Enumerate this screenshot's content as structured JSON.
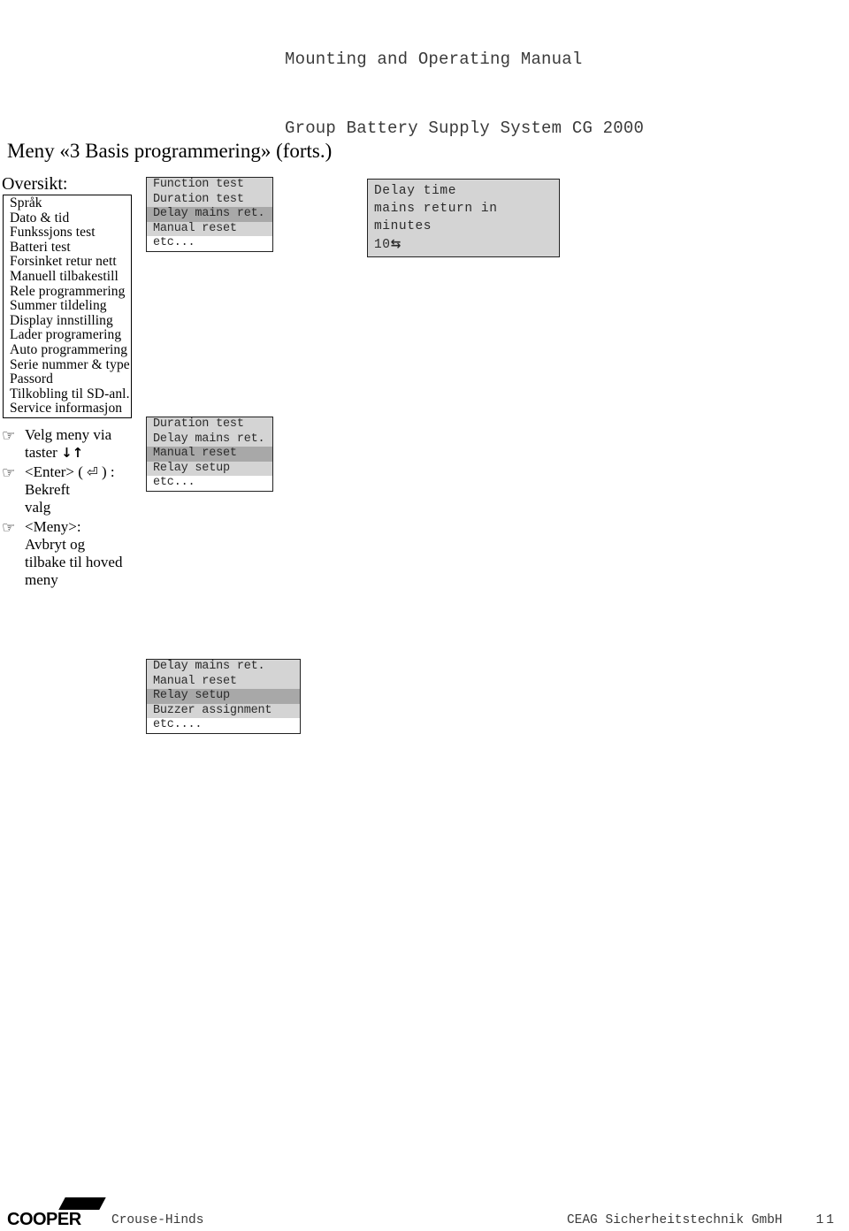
{
  "header": {
    "line1": "Mounting and Operating Manual",
    "line2": "Group Battery Supply System CG 2000"
  },
  "page_title": "Meny «3 Basis programmering» (forts.)",
  "overview": {
    "label": "Oversikt:",
    "items": [
      "Språk",
      "Dato & tid",
      "Funkssjons test",
      "Batteri test",
      "Forsinket retur nett",
      "Manuell tilbakestill",
      "Rele programmering",
      "Summer tildeling",
      "Display innstilling",
      "Lader programering",
      "Auto programmering",
      "Serie nummer & type",
      "Passord",
      "Tilkobling til SD-anl.",
      "Service informasjon"
    ]
  },
  "instructions": [
    {
      "icon": "pointing-hand-icon",
      "text_before": "Velg meny via\ntaster ",
      "glyph": "↓↑",
      "text_after": ""
    },
    {
      "icon": "pointing-hand-icon",
      "text_before": "<Enter>  ( ",
      "glyph": "⏎",
      "text_after": " ) :\nBekreft\nvalg"
    },
    {
      "icon": "pointing-hand-icon",
      "text_before": "<Meny>:\nAvbryt og\ntilbake til hoved\nmeny",
      "glyph": "",
      "text_after": ""
    }
  ],
  "lcd_panels": [
    {
      "name": "panel-1",
      "lines": [
        {
          "text": "Function test",
          "state": "normal"
        },
        {
          "text": "Duration test",
          "state": "normal"
        },
        {
          "text": "Delay mains ret.",
          "state": "selected"
        },
        {
          "text": "Manual reset",
          "state": "normal"
        },
        {
          "text": "etc...",
          "state": "etc"
        }
      ]
    },
    {
      "name": "panel-2",
      "lines": [
        {
          "text": "Duration test",
          "state": "normal"
        },
        {
          "text": "Delay mains ret.",
          "state": "normal"
        },
        {
          "text": "Manual reset",
          "state": "selected"
        },
        {
          "text": "Relay setup",
          "state": "normal"
        },
        {
          "text": "etc...",
          "state": "etc"
        }
      ]
    },
    {
      "name": "panel-3",
      "lines": [
        {
          "text": "Delay mains ret.",
          "state": "normal"
        },
        {
          "text": "Manual reset",
          "state": "normal"
        },
        {
          "text": "Relay setup",
          "state": "selected"
        },
        {
          "text": "Buzzer assignment",
          "state": "normal"
        },
        {
          "text": "etc....",
          "state": "etc"
        }
      ]
    }
  ],
  "delay_time_panel": {
    "line1": "Delay time",
    "line2": "mains return in",
    "line3": "minutes",
    "value": "10",
    "value_glyph": "⇆"
  },
  "footer": {
    "logo_text": "COOPER",
    "logo_subtitle": "Crouse-Hinds",
    "company": "CEAG Sicherheitstechnik GmbH",
    "page_number": "11"
  },
  "colors": {
    "lcd_background": "#d4d4d4",
    "lcd_selected": "#a8a8a8",
    "lcd_text": "#2b2b2b",
    "header_text": "#3a3a3a",
    "border": "#222222"
  }
}
